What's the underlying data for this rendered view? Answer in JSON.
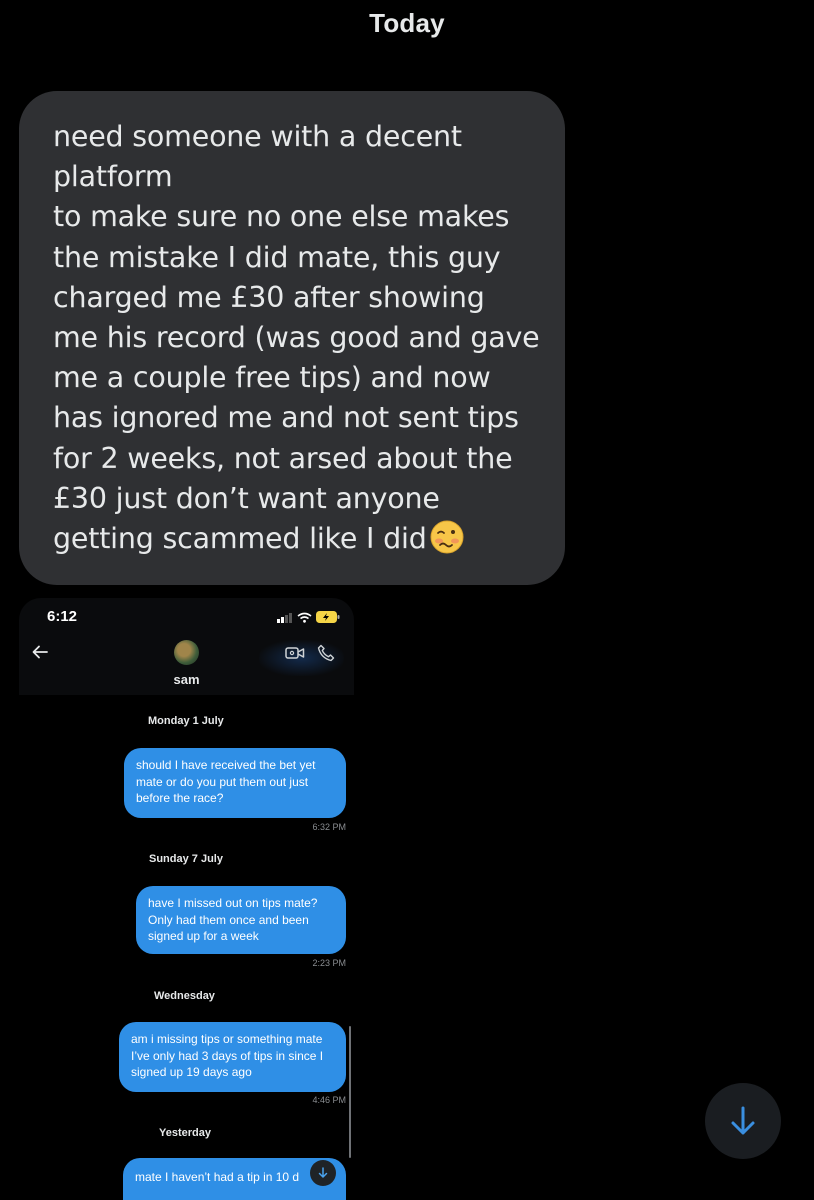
{
  "conversation": {
    "day_header": "Today",
    "received_message": {
      "text": "need someone with a decent\nplatform\nto make sure no one else makes\nthe mistake I did mate, this guy\ncharged me £30 after showing\nme his record (was good and gave\nme a couple free tips) and now\nhas ignored me and not sent tips\nfor 2 weeks, not arsed about the\n£30 just don’t want anyone\ngetting scammed like I did",
      "emoji": "woozy-face"
    }
  },
  "screenshot": {
    "status_time": "6:12",
    "contact_name": "sam",
    "groups": [
      {
        "date": "Monday 1 July",
        "message": "should I have received the bet yet mate or do you put them out just before the race?",
        "time": "6:32 PM"
      },
      {
        "date": "Sunday 7 July",
        "message": "have I missed out on tips mate? Only had them once and been signed up for a week",
        "time": "2:23 PM"
      },
      {
        "date": "Wednesday",
        "message": "am i missing tips or something mate I’ve only had 3 days of tips in since I signed up 19 days ago",
        "time": "4:46 PM"
      },
      {
        "date": "Yesterday",
        "message": "mate I haven’t had a tip in 10 d",
        "time": ""
      }
    ]
  },
  "colors": {
    "background": "#000000",
    "received_bubble": "#2f3033",
    "sent_bubble": "#2f8fe6",
    "accent": "#1d9bf0"
  }
}
